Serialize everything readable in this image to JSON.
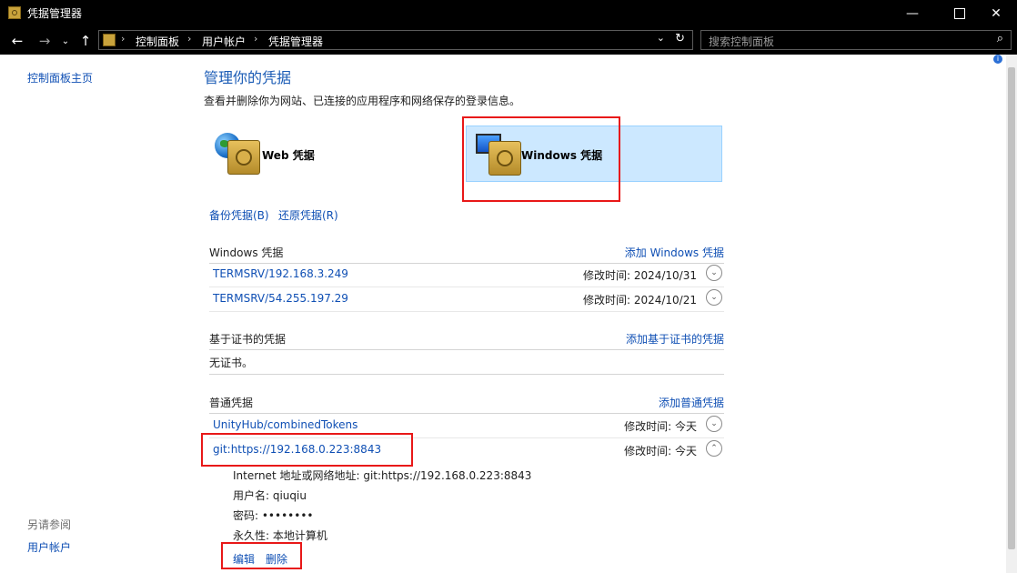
{
  "window": {
    "title": "凭据管理器",
    "minimize_icon": "minimize-icon",
    "maximize_icon": "maximize-icon",
    "close_icon": "close-icon"
  },
  "nav": {
    "back_icon": "back-arrow-icon",
    "forward_icon": "forward-arrow-icon",
    "recent_icon": "chevron-down-icon",
    "up_icon": "up-arrow-icon",
    "breadcrumbs": [
      "控制面板",
      "用户帐户",
      "凭据管理器"
    ],
    "search_placeholder": "搜索控制面板"
  },
  "sidebar": {
    "home_link": "控制面板主页",
    "see_also_label": "另请参阅",
    "see_also_items": [
      "用户帐户"
    ]
  },
  "main": {
    "heading": "管理你的凭据",
    "subtitle": "查看并删除你为网站、已连接的应用程序和网络保存的登录信息。",
    "tiles": [
      {
        "label": "Web 凭据",
        "selected": false
      },
      {
        "label": "Windows 凭据",
        "selected": true
      }
    ],
    "backup_link": "备份凭据(B)",
    "restore_link": "还原凭据(R)",
    "windows_section": {
      "title": "Windows 凭据",
      "add_link": "添加 Windows 凭据",
      "items": [
        {
          "name": "TERMSRV/192.168.3.249",
          "modified": "修改时间:  2024/10/31"
        },
        {
          "name": "TERMSRV/54.255.197.29",
          "modified": "修改时间:  2024/10/21"
        }
      ]
    },
    "cert_section": {
      "title": "基于证书的凭据",
      "add_link": "添加基于证书的凭据",
      "empty_text": "无证书。"
    },
    "generic_section": {
      "title": "普通凭据",
      "add_link": "添加普通凭据",
      "items": [
        {
          "name": "UnityHub/combinedTokens",
          "modified": "修改时间:  今天",
          "expanded": false
        },
        {
          "name": "git:https://192.168.0.223:8843",
          "modified": "修改时间:  今天",
          "expanded": true
        }
      ],
      "details": {
        "address": "Internet 地址或网络地址:  git:https://192.168.0.223:8843",
        "username": "用户名:  qiuqiu",
        "password": "密码:  ••••••••",
        "persistence": "永久性:  本地计算机"
      },
      "edit_link": "编辑",
      "delete_link": "删除"
    }
  },
  "colors": {
    "link": "#0f4fb4",
    "heading": "#1a5bb5",
    "selected_tile": "#cce8ff",
    "highlight_border": "#e81818"
  }
}
